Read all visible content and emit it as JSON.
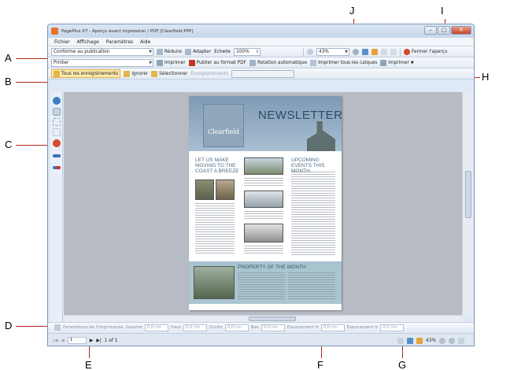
{
  "window": {
    "title": "PagePlus X7 - Aperçu avant impression / PDF [Clearfield.PPP]",
    "controls": [
      "–",
      "□",
      "✕"
    ]
  },
  "menu": [
    "Fichier",
    "Affichage",
    "Paramètres",
    "Aide"
  ],
  "toolbar1": {
    "layout_value": "Conforme au publication",
    "reduce": "Réduire",
    "adapt": "Adapter",
    "scale_label": "Echelle",
    "scale_value": "100%",
    "zoom_value": "43%",
    "close_preview": "Fermer l'aperçu"
  },
  "toolbar2": {
    "printer_value": "Printer",
    "print": "Imprimer",
    "publish_pdf": "Publier au format PDF",
    "auto_rotate": "Rotation automatique",
    "print_layers": "Imprimer tous les calques",
    "print_menu": "Imprimer"
  },
  "toolbar3": {
    "all_records": "Tous les enregistrements",
    "ignore": "Ignorer",
    "select": "Sélectionner",
    "records": "Enregistrements"
  },
  "printer_settings": {
    "title": "Paramètres de l'imprimante",
    "left_label": "Gauche",
    "left_value": "0,0 cm",
    "top_label": "Haut",
    "top_value": "0,0 cm",
    "right_label": "Droite",
    "right_value": "0,0 cm",
    "bottom_label": "Bas",
    "bottom_value": "0,0 cm",
    "hspace_label": "Espacement H",
    "hspace_value": "0,0 cm",
    "vspace_label": "Espacement V",
    "vspace_value": "0,0 cm"
  },
  "status": {
    "page_value": "1",
    "page_of": "1 of 1",
    "zoom": "43%"
  },
  "newsletter": {
    "logo": "Clearfield",
    "title": "NEWSLETTER",
    "heading_left": "LET US MAKE MOVING TO THE COAST A BREEZE",
    "heading_right": "UPCOMING EVENTS THIS MONTH",
    "property_heading": "PROPERTY OF THE MONTH"
  },
  "callouts": [
    "A",
    "B",
    "C",
    "D",
    "E",
    "F",
    "G",
    "H",
    "I",
    "J"
  ],
  "colors": {
    "annotation": "#b3261e",
    "banner": "#8fa6bb",
    "accent": "#4d6d87"
  }
}
